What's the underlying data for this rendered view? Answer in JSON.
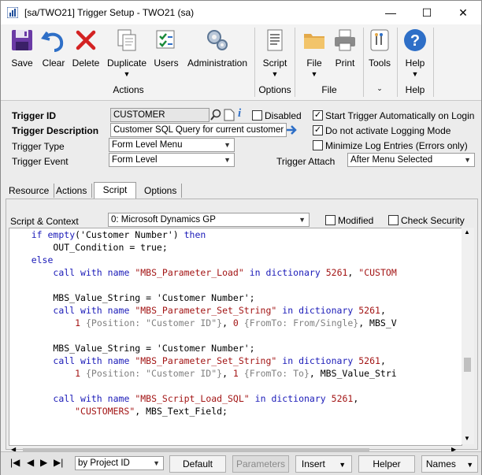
{
  "window": {
    "title": "[sa/TWO21] Trigger Setup  -  TWO21 (sa)",
    "controls": {
      "minimize": "—",
      "maximize": "☐",
      "close": "✕"
    }
  },
  "ribbon": {
    "buttons": [
      {
        "label": "Save",
        "icon": "save-icon"
      },
      {
        "label": "Clear",
        "icon": "undo-icon"
      },
      {
        "label": "Delete",
        "icon": "delete-icon"
      },
      {
        "label": "Duplicate",
        "icon": "duplicate-icon"
      },
      {
        "label": "Users",
        "icon": "users-icon"
      },
      {
        "label": "Administration",
        "icon": "gears-icon"
      },
      {
        "label": "Script",
        "icon": "script-icon"
      },
      {
        "label": "File",
        "icon": "folder-icon"
      },
      {
        "label": "Print",
        "icon": "printer-icon"
      },
      {
        "label": "Tools",
        "icon": "tools-icon"
      },
      {
        "label": "Help",
        "icon": "help-icon"
      }
    ],
    "groups": {
      "actions": "Actions",
      "options": "Options",
      "file": "File",
      "help": "Help"
    }
  },
  "header": {
    "trigger_id_label": "Trigger ID",
    "trigger_id_value": "CUSTOMER",
    "disabled_label": "Disabled",
    "disabled_checked": false,
    "trigger_desc_label": "Trigger Description",
    "trigger_desc_value": "Customer SQL Query for current customer",
    "trigger_type_label": "Trigger Type",
    "trigger_type_value": "Form Level Menu",
    "trigger_event_label": "Trigger Event",
    "trigger_event_value": "Form Level",
    "trigger_attach_label": "Trigger Attach",
    "trigger_attach_value": "After Menu Selected",
    "opt_start_label": "Start Trigger Automatically on Login",
    "opt_start_checked": true,
    "opt_nolog_label": "Do not activate Logging Mode",
    "opt_nolog_checked": true,
    "opt_minlog_label": "Minimize Log Entries (Errors only)",
    "opt_minlog_checked": false
  },
  "tabs": [
    "Resource",
    "Actions",
    "Script",
    "Options"
  ],
  "active_tab": "Script",
  "script": {
    "context_label": "Script & Context",
    "context_value": "0: Microsoft Dynamics GP",
    "modified_label": "Modified",
    "check_security_label": "Check Security"
  },
  "code_lines": [
    "    if empty('Customer Number') then",
    "        OUT_Condition = true;",
    "    else",
    "        call with name \"MBS_Parameter_Load\" in dictionary 5261, \"CUSTOM",
    "",
    "        MBS_Value_String = 'Customer Number';",
    "        call with name \"MBS_Parameter_Set_String\" in dictionary 5261,",
    "            1 {Position: \"Customer ID\"}, 0 {FromTo: From/Single}, MBS_V",
    "",
    "        MBS_Value_String = 'Customer Number';",
    "        call with name \"MBS_Parameter_Set_String\" in dictionary 5261,",
    "            1 {Position: \"Customer ID\"}, 1 {FromTo: To}, MBS_Value_Stri",
    "",
    "        call with name \"MBS_Script_Load_SQL\" in dictionary 5261,",
    "            \"CUSTOMERS\", MBS_Text_Field;"
  ],
  "bottom": {
    "sort_value": "by Project ID",
    "default_label": "Default",
    "parameters_label": "Parameters",
    "insert_label": "Insert",
    "helper_label": "Helper",
    "names_label": "Names"
  }
}
